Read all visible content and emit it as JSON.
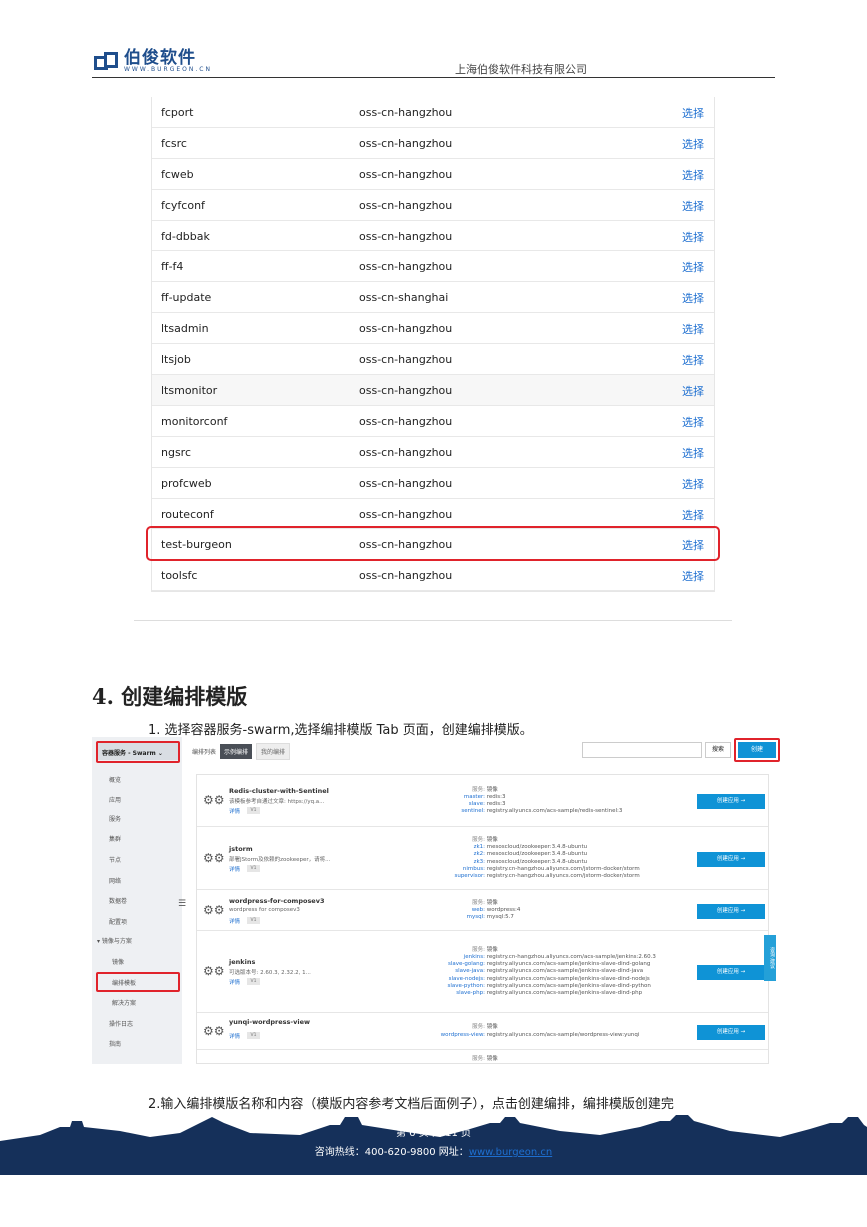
{
  "header": {
    "logo_text": "伯俊软件",
    "logo_sub": "WWW.BURGEON.CN",
    "company": "上海伯俊软件科技有限公司"
  },
  "buckets": [
    {
      "name": "fcport",
      "region": "oss-cn-hangzhou",
      "action": "选择"
    },
    {
      "name": "fcsrc",
      "region": "oss-cn-hangzhou",
      "action": "选择"
    },
    {
      "name": "fcweb",
      "region": "oss-cn-hangzhou",
      "action": "选择"
    },
    {
      "name": "fcyfconf",
      "region": "oss-cn-hangzhou",
      "action": "选择"
    },
    {
      "name": "fd-dbbak",
      "region": "oss-cn-hangzhou",
      "action": "选择"
    },
    {
      "name": "ff-f4",
      "region": "oss-cn-hangzhou",
      "action": "选择"
    },
    {
      "name": "ff-update",
      "region": "oss-cn-shanghai",
      "action": "选择"
    },
    {
      "name": "ltsadmin",
      "region": "oss-cn-hangzhou",
      "action": "选择"
    },
    {
      "name": "ltsjob",
      "region": "oss-cn-hangzhou",
      "action": "选择"
    },
    {
      "name": "ltsmonitor",
      "region": "oss-cn-hangzhou",
      "action": "选择"
    },
    {
      "name": "monitorconf",
      "region": "oss-cn-hangzhou",
      "action": "选择"
    },
    {
      "name": "ngsrc",
      "region": "oss-cn-hangzhou",
      "action": "选择"
    },
    {
      "name": "profcweb",
      "region": "oss-cn-hangzhou",
      "action": "选择"
    },
    {
      "name": "routeconf",
      "region": "oss-cn-hangzhou",
      "action": "选择"
    },
    {
      "name": "test-burgeon",
      "region": "oss-cn-hangzhou",
      "action": "选择"
    },
    {
      "name": "toolsfc",
      "region": "oss-cn-hangzhou",
      "action": "选择"
    }
  ],
  "section": {
    "heading": "4. 创建编排模版",
    "step1": "1.   选择容器服务-swarm,选择编排模版 Tab 页面，创建编排模版。",
    "step2": "2.输入编排模版名称和内容（模版内容参考文档后面例子），点击创建编排，编排模版创建完"
  },
  "console": {
    "sidebar_head": "容器服务 - Swarm ⌄",
    "sidebar_items": [
      "概览",
      "应用",
      "服务",
      "集群",
      "节点",
      "网络",
      "数据卷",
      "配置项",
      "▾ 镜像与方案",
      "镜像",
      "编排模板",
      "解决方案",
      "操作日志",
      "指南"
    ],
    "tab_label": "编排列表",
    "tab_on": "示例编排",
    "tab_off": "我的编排",
    "search_label": "搜索",
    "create_label": "创建",
    "side_tab": "咨询·建议",
    "templates": [
      {
        "name": "Redis-cluster-with-Sentinel",
        "desc": "该模板参考自通过文章: https://yq.a...",
        "link": "详情",
        "tag": "V1",
        "button": "创建应用 →",
        "services": [
          {
            "k": "服务:",
            "v": "镜像"
          },
          {
            "k": "master:",
            "v": "redis:3"
          },
          {
            "k": "slave:",
            "v": "redis:3"
          },
          {
            "k": "sentinel:",
            "v": "registry.aliyuncs.com/acs-sample/redis-sentinel:3"
          }
        ]
      },
      {
        "name": "jstorm",
        "desc": "部署JStorm及依赖的zookeeper，请将...",
        "link": "详情",
        "tag": "V1",
        "button": "创建应用 →",
        "services": [
          {
            "k": "服务:",
            "v": "镜像"
          },
          {
            "k": "zk1:",
            "v": "mesoscloud/zookeeper:3.4.8-ubuntu"
          },
          {
            "k": "zk2:",
            "v": "mesoscloud/zookeeper:3.4.8-ubuntu"
          },
          {
            "k": "zk3:",
            "v": "mesoscloud/zookeeper:3.4.8-ubuntu"
          },
          {
            "k": "nimbus:",
            "v": "registry.cn-hangzhou.aliyuncs.com/jstorm-docker/storm"
          },
          {
            "k": "supervisor:",
            "v": "registry.cn-hangzhou.aliyuncs.com/jstorm-docker/storm"
          }
        ]
      },
      {
        "name": "wordpress-for-composev3",
        "desc": "wordpress for composev3",
        "link": "详情",
        "tag": "V1",
        "button": "创建应用 →",
        "services": [
          {
            "k": "服务:",
            "v": "镜像"
          },
          {
            "k": "web:",
            "v": "wordpress:4"
          },
          {
            "k": "mysql:",
            "v": "mysql:5.7"
          }
        ]
      },
      {
        "name": "jenkins",
        "desc": "可选版本号: 2.60.3, 2.32.2, 1...",
        "link": "详情",
        "tag": "V1",
        "button": "创建应用 →",
        "services": [
          {
            "k": "服务:",
            "v": "镜像"
          },
          {
            "k": "jenkins:",
            "v": "registry.cn-hangzhou.aliyuncs.com/acs-sample/jenkins:2.60.3"
          },
          {
            "k": "slave-golang:",
            "v": "registry.aliyuncs.com/acs-sample/jenkins-slave-dind-golang"
          },
          {
            "k": "slave-java:",
            "v": "registry.aliyuncs.com/acs-sample/jenkins-slave-dind-java"
          },
          {
            "k": "slave-nodejs:",
            "v": "registry.aliyuncs.com/acs-sample/jenkins-slave-dind-nodejs"
          },
          {
            "k": "slave-python:",
            "v": "registry.aliyuncs.com/acs-sample/jenkins-slave-dind-python"
          },
          {
            "k": "slave-php:",
            "v": "registry.aliyuncs.com/acs-sample/jenkins-slave-dind-php"
          }
        ]
      },
      {
        "name": "yunqi-wordpress-view",
        "desc": "",
        "link": "详情",
        "tag": "V1",
        "button": "创建应用 →",
        "services": [
          {
            "k": "服务:",
            "v": "镜像"
          },
          {
            "k": "wordpress-view:",
            "v": "registry.aliyuncs.com/acs-sample/wordpress-view:yunqi"
          }
        ]
      },
      {
        "name": "",
        "desc": "",
        "link": "",
        "tag": "",
        "button": "",
        "services": [
          {
            "k": "服务:",
            "v": "镜像"
          }
        ]
      }
    ]
  },
  "footer": {
    "page": "第 6 页  共 11 页",
    "hotline_label": "咨询热线：400-620-9800    网址：",
    "url": "www.burgeon.cn"
  }
}
